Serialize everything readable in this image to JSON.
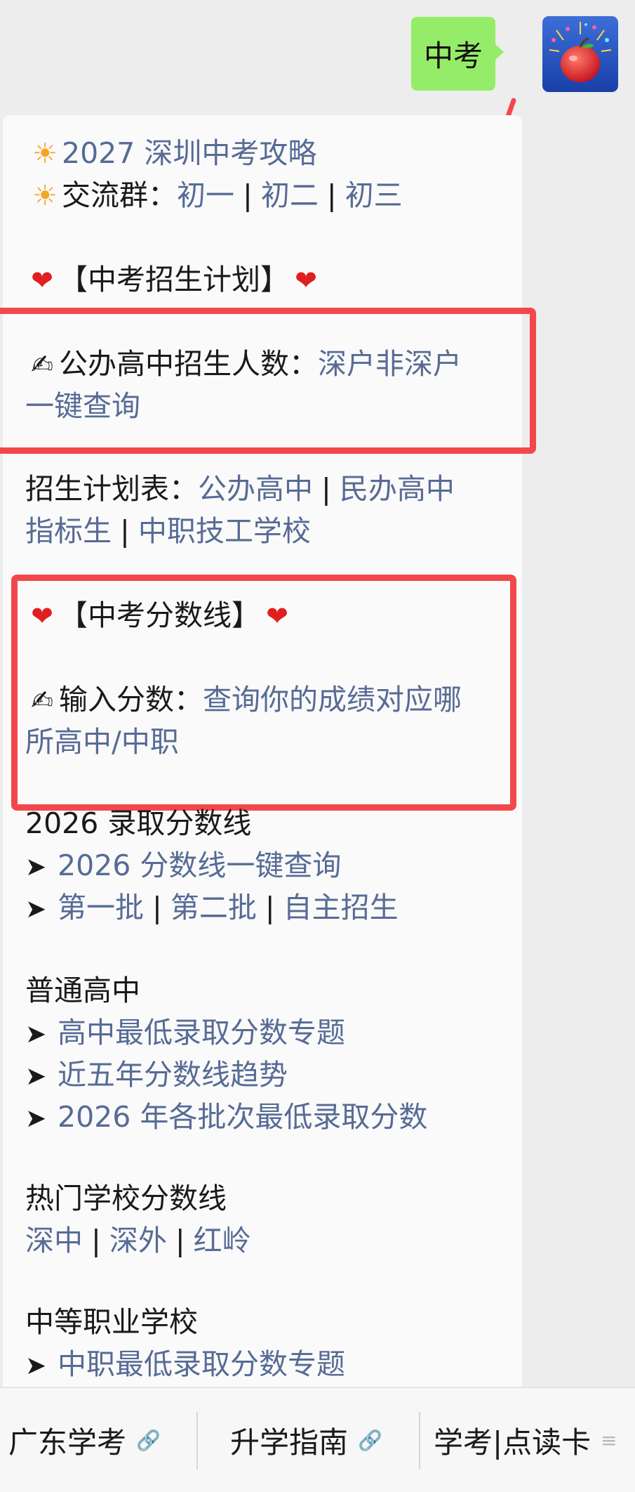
{
  "chat": {
    "user_message": "中考"
  },
  "reply": {
    "title": "2027 深圳中考攻略",
    "group_label": "交流群：",
    "groups": [
      "初一",
      "初二",
      "初三"
    ],
    "sep": "|",
    "sec1_heading": "【中考招生计划】",
    "public_label": "公办高中招生人数：",
    "public_links": [
      "深户非深户",
      "一键查询"
    ],
    "plan_label": "招生计划表：",
    "plan_links": [
      "公办高中",
      "民办高中",
      "指标生",
      "中职技工学校"
    ],
    "sec2_heading": "【中考分数线】",
    "input_label": "输入分数：",
    "input_link_1": "查询你的成绩对应哪",
    "input_link_2": "所高中/中职",
    "luqu_heading": "2026 录取分数线",
    "luqu_link": "2026 分数线一键查询",
    "batch_links": [
      "第一批",
      "第二批",
      "自主招生"
    ],
    "ordinary_heading": "普通高中",
    "ordinary_links": [
      "高中最低录取分数专题",
      "近五年分数线趋势",
      "2026 年各批次最低录取分数"
    ],
    "hot_heading": "热门学校分数线",
    "hot_links": [
      "深中",
      "深外",
      "红岭"
    ],
    "vocational_heading": "中等职业学校",
    "vocational_link": "中职最低录取分数专题"
  },
  "menu": {
    "items": [
      "广东学考",
      "升学指南",
      "学考|点读卡"
    ]
  },
  "colors": {
    "link": "#576b95",
    "bubble": "#95ec69",
    "highlight_box": "#f2484b"
  },
  "icons": {
    "sun": "sun-icon",
    "heart": "heart-icon",
    "writing": "writing-hand-icon",
    "arrow": "arrow-right-icon",
    "link": "link-icon",
    "menu": "hamburger-icon"
  }
}
